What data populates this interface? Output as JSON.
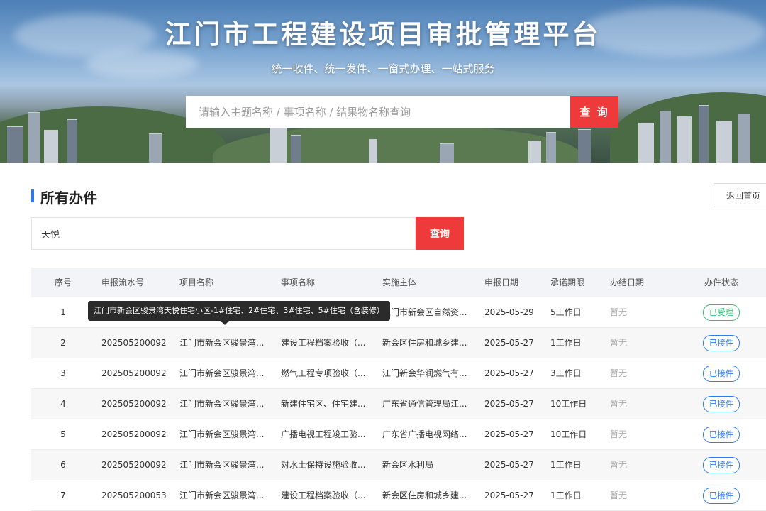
{
  "header": {
    "title": "江门市工程建设项目审批管理平台",
    "subtitle": "统一收件、统一发件、一窗式办理、一站式服务",
    "search_placeholder": "请输入主题名称 / 事项名称 / 结果物名称查询",
    "search_button": "查 询"
  },
  "section": {
    "title": "所有办件",
    "back_button": "返回首页"
  },
  "filter": {
    "value": "天悦",
    "button": "查询"
  },
  "table": {
    "headers": [
      "序号",
      "申报流水号",
      "项目名称",
      "事项名称",
      "实施主体",
      "申报日期",
      "承诺期限",
      "办结日期",
      "办件状态"
    ],
    "rows": [
      {
        "no": "1",
        "serial": "",
        "project": "",
        "item": "",
        "org": "江门市新会区自然资...",
        "date": "2025-05-29",
        "limit": "5工作日",
        "done": "暂无",
        "status": "已受理"
      },
      {
        "no": "2",
        "serial": "202505200092",
        "project": "江门市新会区骏景湾...",
        "item": "建设工程档案验收（...",
        "org": "新会区住房和城乡建...",
        "date": "2025-05-27",
        "limit": "1工作日",
        "done": "暂无",
        "status": "已接件"
      },
      {
        "no": "3",
        "serial": "202505200092",
        "project": "江门市新会区骏景湾...",
        "item": "燃气工程专项验收（...",
        "org": "江门新会华润燃气有...",
        "date": "2025-05-27",
        "limit": "3工作日",
        "done": "暂无",
        "status": "已接件"
      },
      {
        "no": "4",
        "serial": "202505200092",
        "project": "江门市新会区骏景湾...",
        "item": "新建住宅区、住宅建...",
        "org": "广东省通信管理局江...",
        "date": "2025-05-27",
        "limit": "10工作日",
        "done": "暂无",
        "status": "已接件"
      },
      {
        "no": "5",
        "serial": "202505200092",
        "project": "江门市新会区骏景湾...",
        "item": "广播电视工程竣工验...",
        "org": "广东省广播电视网络...",
        "date": "2025-05-27",
        "limit": "10工作日",
        "done": "暂无",
        "status": "已接件"
      },
      {
        "no": "6",
        "serial": "202505200092",
        "project": "江门市新会区骏景湾...",
        "item": "对水土保持设施验收...",
        "org": "新会区水利局",
        "date": "2025-05-27",
        "limit": "1工作日",
        "done": "暂无",
        "status": "已接件"
      },
      {
        "no": "7",
        "serial": "202505200053",
        "project": "江门市新会区骏景湾...",
        "item": "建设工程档案验收（...",
        "org": "新会区住房和城乡建...",
        "date": "2025-05-27",
        "limit": "1工作日",
        "done": "暂无",
        "status": "已接件"
      }
    ]
  },
  "tooltip": "江门市新会区骏景湾天悦住宅小区-1#住宅、2#住宅、3#住宅、5#住宅（含装修）",
  "colors": {
    "accent_red": "#ee3a3a",
    "accent_blue": "#2e7bf0",
    "status_green": "#2fbf71"
  }
}
